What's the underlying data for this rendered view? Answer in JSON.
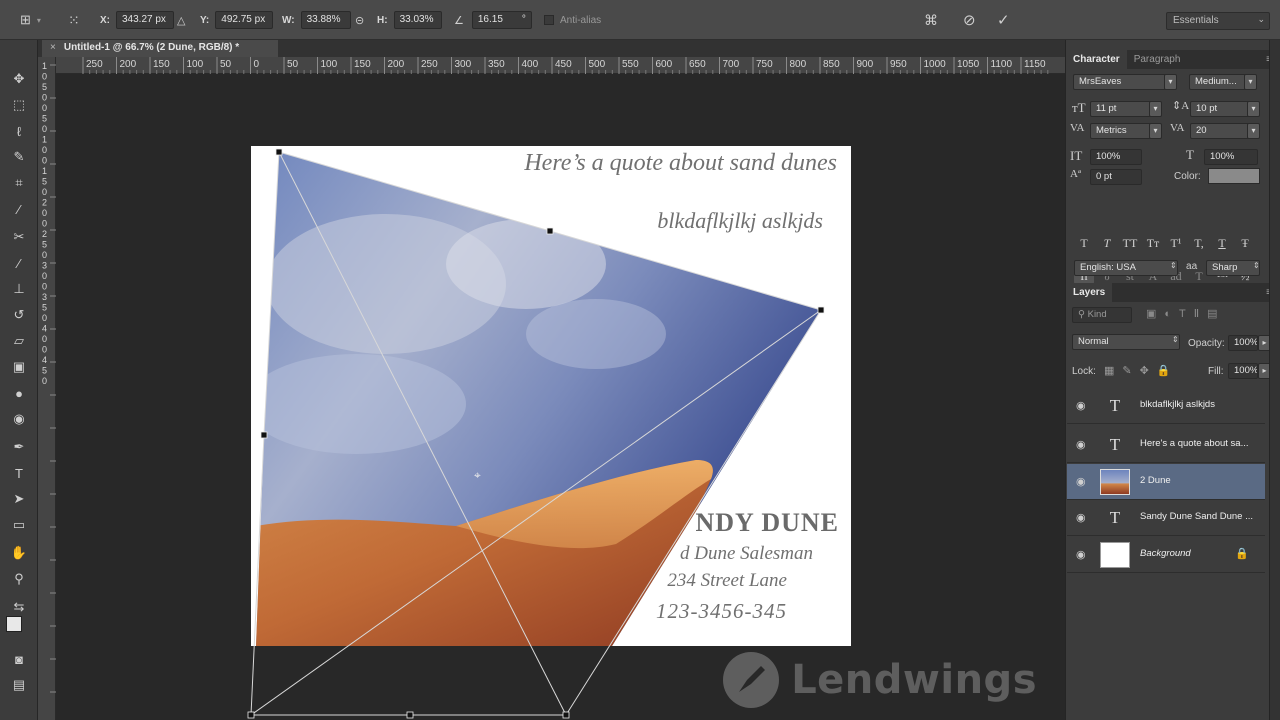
{
  "options_bar": {
    "x_label": "X:",
    "x_value": "343.27 px",
    "y_label": "Y:",
    "y_value": "492.75 px",
    "w_label": "W:",
    "w_value": "33.88%",
    "h_label": "H:",
    "h_value": "33.03%",
    "angle_value": "16.15",
    "angle_unit": "°",
    "antialias_label": "Anti-alias",
    "workspace": "Essentials",
    "icons": [
      "move-tool-options-icon",
      "reference-point-icon",
      "delta-icon",
      "link-icon",
      "warp-icon",
      "cancel-transform-icon",
      "commit-transform-icon"
    ]
  },
  "document": {
    "tab_title": "Untitled-1 @ 66.7% (2 Dune, RGB/8) *",
    "quote": "Here’s a quote about sand dunes",
    "subline": "blkdaflkjlkj aslkjds",
    "name": "NDY DUNE",
    "title": "d Dune Salesman",
    "address": "234 Street Lane",
    "phone": "123-3456-345"
  },
  "ruler": {
    "ticks": [
      "250",
      "200",
      "150",
      "100",
      "50",
      "0",
      "50",
      "100",
      "150",
      "200",
      "250",
      "300",
      "350",
      "400",
      "450",
      "500",
      "550",
      "600",
      "650",
      "700",
      "750",
      "800",
      "850",
      "900",
      "950",
      "1000",
      "1050",
      "1100",
      "1150"
    ],
    "vticks": [
      "1",
      "0",
      "5",
      "0",
      "0",
      "5",
      "0",
      "1",
      "0",
      "0",
      "1",
      "5",
      "0",
      "2",
      "0",
      "0",
      "2",
      "5",
      "0",
      "3",
      "0",
      "0",
      "3",
      "5",
      "0",
      "4",
      "0",
      "0",
      "4",
      "5",
      "0"
    ]
  },
  "character_panel": {
    "tabs": [
      "Character",
      "Paragraph"
    ],
    "font_family": "MrsEaves",
    "font_style": "Medium...",
    "font_size": "11 pt",
    "leading": "10 pt",
    "kerning": "Metrics",
    "tracking": "20",
    "vertical_scale": "100%",
    "horizontal_scale": "100%",
    "baseline_shift": "0 pt",
    "color_label": "Color:",
    "style_buttons": [
      "T",
      "T",
      "TT",
      "Tт",
      "T¹",
      "T,",
      "T",
      "Ŧ"
    ],
    "opentype_buttons": [
      "fi",
      "ℴ",
      "st",
      "A",
      "ad",
      "T",
      "1st",
      "½"
    ],
    "language": "English: USA",
    "aa_label": "a",
    "antialias": "Sharp"
  },
  "layers_panel": {
    "title": "Layers",
    "filter": "Kind",
    "blend_mode": "Normal",
    "opacity_label": "Opacity:",
    "opacity": "100%",
    "lock_label": "Lock:",
    "fill_label": "Fill:",
    "fill": "100%",
    "layers": [
      {
        "name": "blkdaflkjlkj aslkjds",
        "type": "text"
      },
      {
        "name": "Here's a quote about sa...",
        "type": "text"
      },
      {
        "name": "2 Dune",
        "type": "image",
        "selected": true
      },
      {
        "name": "Sandy Dune Sand Dune ...",
        "type": "text"
      },
      {
        "name": "Background",
        "type": "background"
      }
    ]
  },
  "watermark": "Lendwings",
  "colors": {
    "selection": "#5a6a84",
    "panel": "#3c3c3c",
    "canvas_bg": "#282828"
  }
}
